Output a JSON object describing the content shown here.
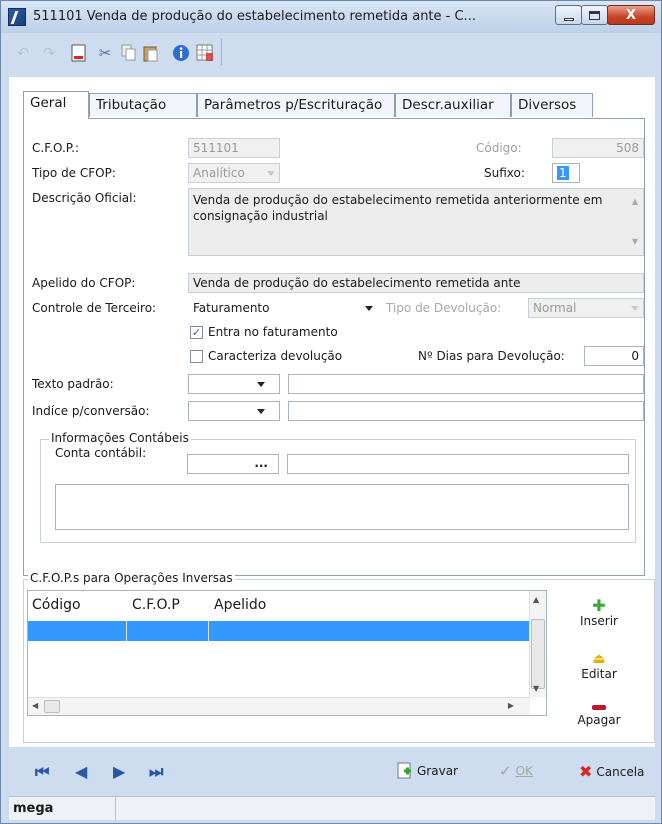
{
  "window": {
    "title": "511101 Venda de produção do estabelecimento remetida ante - C...",
    "close_glyph": "X"
  },
  "toolbar": {
    "icons": [
      "undo-icon",
      "redo-icon",
      "new-doc-icon",
      "cut-icon",
      "copy-icon",
      "paste-icon",
      "info-icon",
      "grid-icon"
    ]
  },
  "tabs": [
    {
      "label": "Geral",
      "underline": "e"
    },
    {
      "label": "Tributação"
    },
    {
      "label": "Parâmetros p/Escrituração"
    },
    {
      "label": "Descr.auxiliar"
    },
    {
      "label": "Diversos"
    }
  ],
  "form": {
    "cfop_label": "C.F.O.P.:",
    "cfop_value": "511101",
    "codigo_label": "Código:",
    "codigo_value": "508",
    "tipo_label": "Tipo de CFOP:",
    "tipo_value": "Analítico",
    "sufixo_label": "Sufixo:",
    "sufixo_value": "1",
    "descricao_label": "Descrição Oficial:",
    "descricao_value": "Venda de produção do estabelecimento remetida anteriormente em consignação industrial",
    "apelido_label": "Apelido do CFOP:",
    "apelido_value": "Venda de produção do estabelecimento remetida ante",
    "controle_label": "Controle de Terceiro:",
    "controle_value": "Faturamento",
    "tipo_dev_label": "Tipo de Devolução:",
    "tipo_dev_value": "Normal",
    "entra_label": "Entra no faturamento",
    "caracteriza_label": "Caracteriza devolução",
    "dias_label": "Nº Dias para Devolução:",
    "dias_value": "0",
    "texto_label": "Texto padrão:",
    "indice_label": "Indíce p/conversão:",
    "info_group": "Informações Contábeis",
    "conta_label": "Conta contábil:",
    "conta_btn": "..."
  },
  "inversas": {
    "group": "C.F.O.P.s para Operações Inversas",
    "columns": [
      "Código",
      "C.F.O.P",
      "Apelido"
    ],
    "inserir": "Inserir",
    "editar": "Editar",
    "apagar": "Apagar"
  },
  "footer": {
    "gravar": "Gravar",
    "ok": "OK",
    "cancela": "Cancela"
  },
  "status": {
    "user": "mega"
  }
}
